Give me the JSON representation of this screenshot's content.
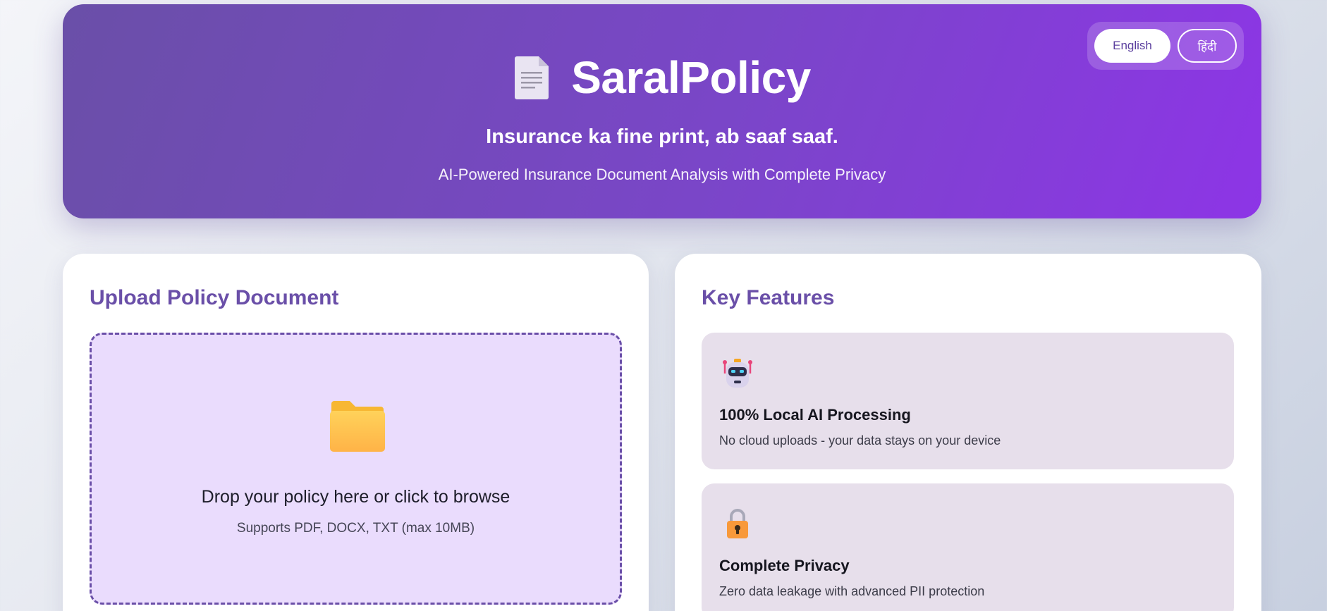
{
  "header": {
    "title": "SaralPolicy",
    "tagline": "Insurance ka fine print, ab saaf saaf.",
    "subtitle": "AI-Powered Insurance Document Analysis with Complete Privacy",
    "icon": "document-icon",
    "language": {
      "options": [
        "English",
        "हिंदी"
      ],
      "selected": "English"
    }
  },
  "upload": {
    "title": "Upload Policy Document",
    "icon": "folder-icon",
    "drop_title": "Drop your policy here or click to browse",
    "drop_subtitle": "Supports PDF, DOCX, TXT (max 10MB)"
  },
  "features": {
    "title": "Key Features",
    "items": [
      {
        "icon": "robot-icon",
        "title": "100% Local AI Processing",
        "description": "No cloud uploads - your data stays on your device"
      },
      {
        "icon": "lock-icon",
        "title": "Complete Privacy",
        "description": "Zero data leakage with advanced PII protection"
      }
    ]
  },
  "colors": {
    "brand": "#6a4fa8",
    "header_gradient_end": "#8d35e6",
    "dropzone_bg": "#eadcfd",
    "feature_bg": "#e7dfeb"
  }
}
